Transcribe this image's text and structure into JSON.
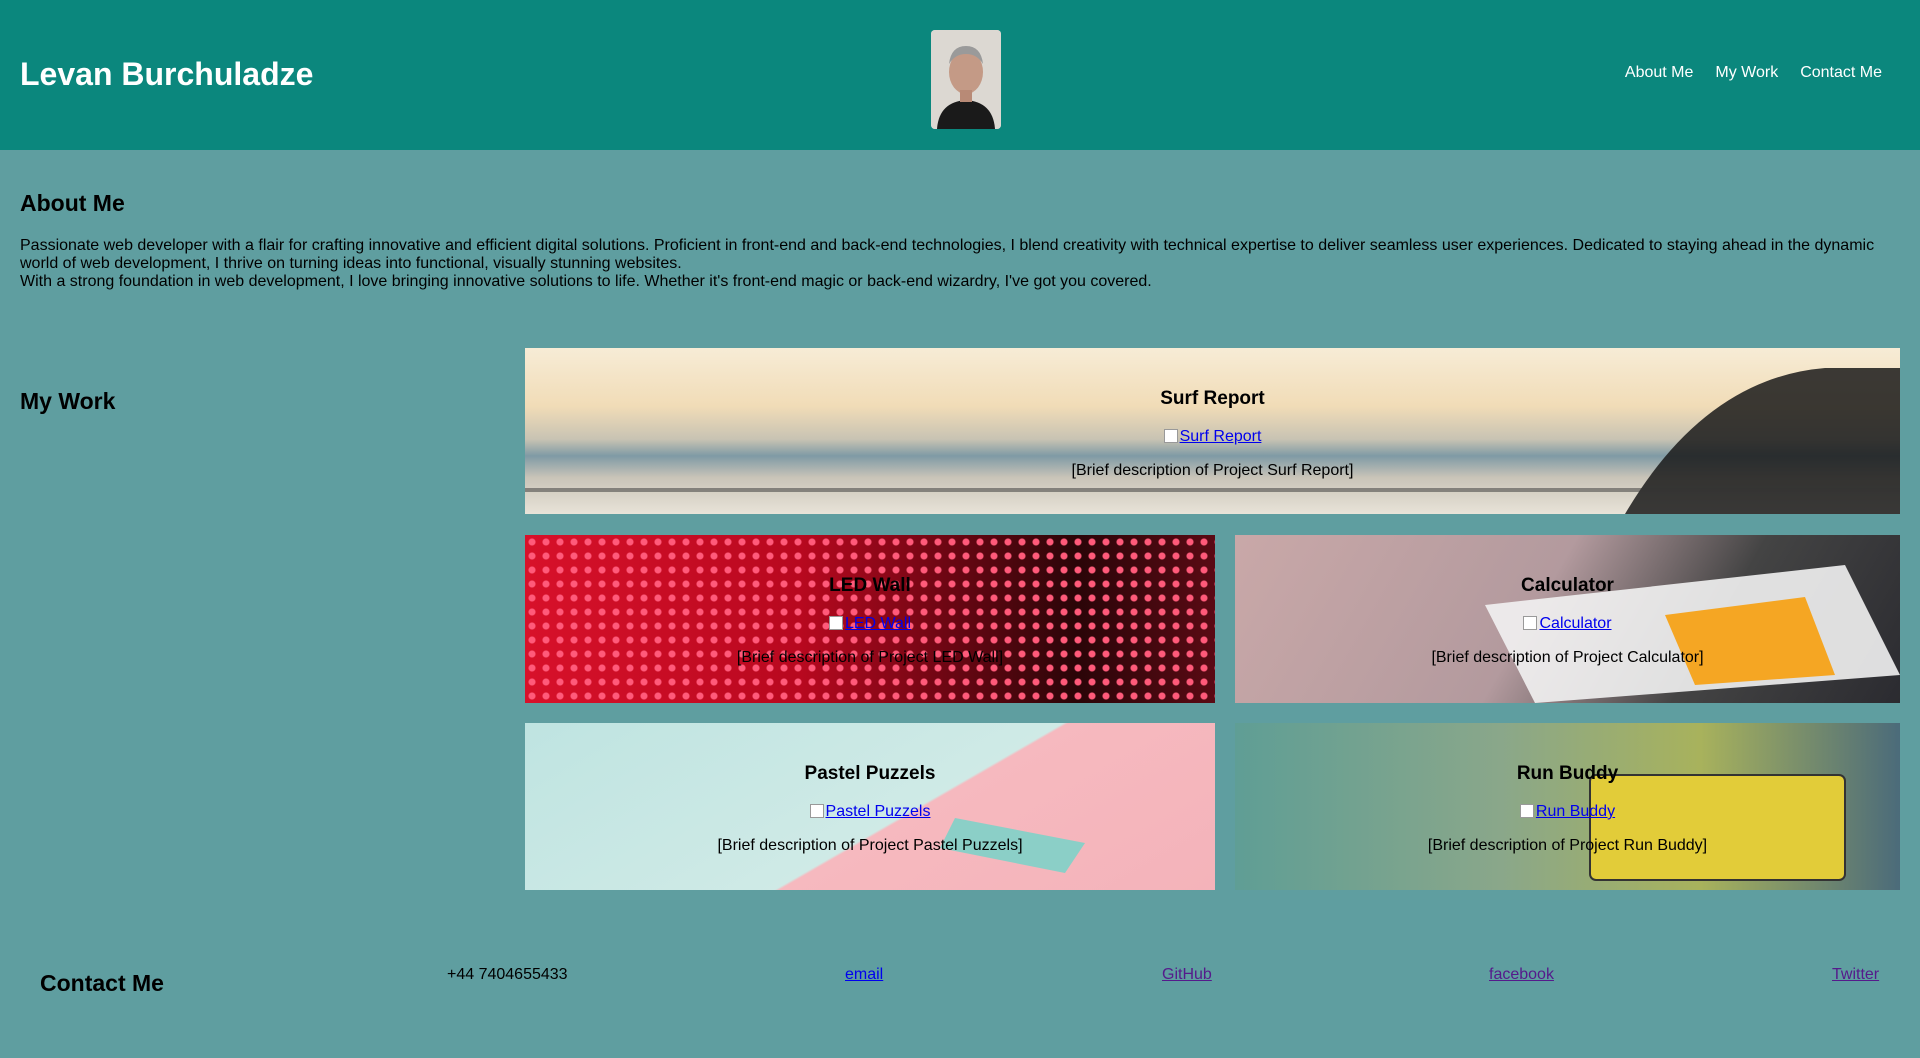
{
  "header": {
    "title": "Levan Burchuladze",
    "nav": [
      "About Me",
      "My Work",
      "Contact Me"
    ]
  },
  "about": {
    "title": "About Me",
    "paragraph1": "Passionate web developer with a flair for crafting innovative and efficient digital solutions. Proficient in front-end and back-end technologies, I blend creativity with technical expertise to deliver seamless user experiences. Dedicated to staying ahead in the dynamic world of web development, I thrive on turning ideas into functional, visually stunning websites.",
    "paragraph2": "With a strong foundation in web development, I love bringing innovative solutions to life. Whether it's front-end magic or back-end wizardry, I've got you covered."
  },
  "work": {
    "title": "My Work",
    "projects": [
      {
        "name": "Surf Report",
        "link": "Surf Report",
        "desc": "[Brief description of Project Surf Report]"
      },
      {
        "name": "LED Wall",
        "link": "LED Wall",
        "desc": "[Brief description of Project LED Wall]"
      },
      {
        "name": "Calculator",
        "link": "Calculator",
        "desc": "[Brief description of Project Calculator]"
      },
      {
        "name": "Pastel Puzzels",
        "link": "Pastel Puzzels",
        "desc": "[Brief description of Project Pastel Puzzels]"
      },
      {
        "name": "Run Buddy",
        "link": "Run Buddy",
        "desc": "[Brief description of Project Run Buddy]"
      }
    ]
  },
  "contact": {
    "title": "Contact Me",
    "phone": "+44 7404655433",
    "email": "email",
    "github": "GitHub",
    "facebook": "facebook",
    "twitter": "Twitter"
  },
  "colors": {
    "header_bg": "#0b877d",
    "page_bg": "#5f9ea0"
  }
}
